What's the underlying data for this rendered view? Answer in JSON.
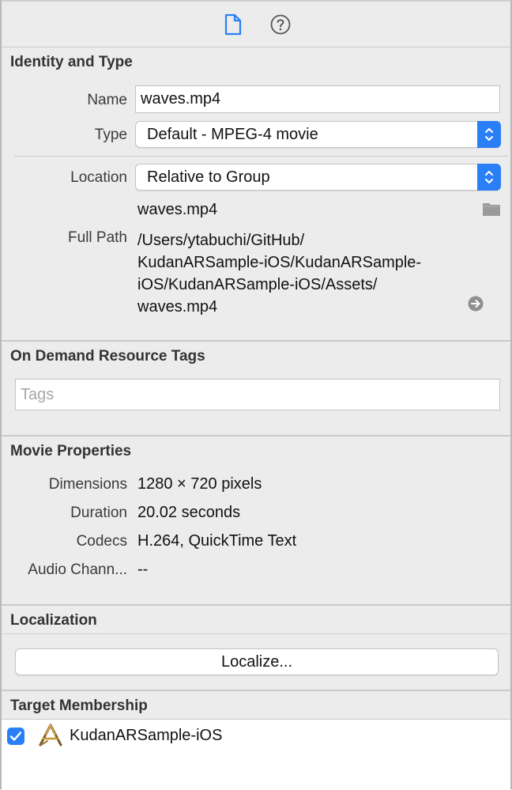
{
  "toolbar": {
    "file_inspector_icon": "file-inspector-icon",
    "quick_help_icon": "quick-help-icon",
    "accent": "#2a7ff6"
  },
  "identity": {
    "title": "Identity and Type",
    "name_label": "Name",
    "name_value": "waves.mp4",
    "type_label": "Type",
    "type_value": "Default - MPEG-4 movie",
    "location_label": "Location",
    "location_value": "Relative to Group",
    "file_name": "waves.mp4",
    "full_path_label": "Full Path",
    "full_path_lines": [
      "/Users/ytabuchi/GitHub/",
      "KudanARSample-iOS/KudanARSample-",
      "iOS/KudanARSample-iOS/Assets/",
      "waves.mp4"
    ]
  },
  "on_demand": {
    "title": "On Demand Resource Tags",
    "tags_placeholder": "Tags"
  },
  "movie": {
    "title": "Movie Properties",
    "rows": [
      {
        "label": "Dimensions",
        "value": "1280 × 720 pixels"
      },
      {
        "label": "Duration",
        "value": "20.02 seconds"
      },
      {
        "label": "Codecs",
        "value": "H.264, QuickTime Text"
      },
      {
        "label": "Audio Chann...",
        "value": "--"
      }
    ]
  },
  "localization": {
    "title": "Localization",
    "button_label": "Localize..."
  },
  "target": {
    "title": "Target Membership",
    "items": [
      {
        "name": "KudanARSample-iOS",
        "checked": true
      }
    ]
  }
}
